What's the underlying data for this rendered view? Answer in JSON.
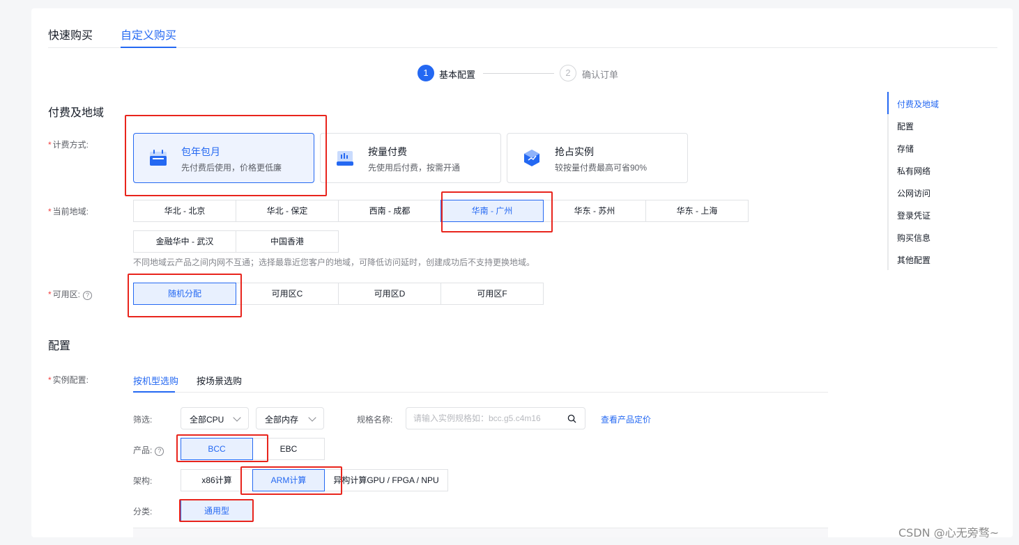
{
  "top_tabs": [
    {
      "label": "快速购买",
      "active": false
    },
    {
      "label": "自定义购买",
      "active": true
    }
  ],
  "steps": [
    {
      "num": "1",
      "label": "基本配置",
      "active": true
    },
    {
      "num": "2",
      "label": "确认订单",
      "active": false
    }
  ],
  "sections": {
    "billing_region": "付费及地域",
    "config": "配置"
  },
  "billing": {
    "label": "计费方式:",
    "cards": [
      {
        "title": "包年包月",
        "desc": "先付费后使用，价格更低廉",
        "icon": "calendar-icon",
        "selected": true
      },
      {
        "title": "按量付费",
        "desc": "先使用后付费，按需开通",
        "icon": "meter-icon",
        "selected": false
      },
      {
        "title": "抢占实例",
        "desc": "较按量付费最高可省90%",
        "icon": "cube-icon",
        "selected": false
      }
    ]
  },
  "region": {
    "label": "当前地域:",
    "options": [
      "华北 - 北京",
      "华北 - 保定",
      "西南 - 成都",
      "华南 - 广州",
      "华东 - 苏州",
      "华东 - 上海",
      "金融华中 - 武汉",
      "中国香港"
    ],
    "selected": "华南 - 广州",
    "hint": "不同地域云产品之间内网不互通；选择最靠近您客户的地域，可降低访问延时，创建成功后不支持更换地域。"
  },
  "zone": {
    "label": "可用区:",
    "help": "?",
    "options": [
      "随机分配",
      "可用区C",
      "可用区D",
      "可用区F"
    ],
    "selected": "随机分配"
  },
  "right_nav": {
    "items": [
      "付费及地域",
      "配置",
      "存储",
      "私有网络",
      "公网访问",
      "登录凭证",
      "购买信息",
      "其他配置"
    ],
    "active": "付费及地域"
  },
  "instance": {
    "label": "实例配置:",
    "tabs": [
      {
        "label": "按机型选购",
        "active": true
      },
      {
        "label": "按场景选购",
        "active": false
      }
    ],
    "filter_label": "筛选:",
    "cpu_select": "全部CPU",
    "mem_select": "全部内存",
    "spec_label": "规格名称:",
    "spec_placeholder": "请输入实例规格如：bcc.g5.c4m16",
    "pricing_link": "查看产品定价",
    "product_label": "产品:",
    "products": [
      "BCC",
      "EBC"
    ],
    "product_selected": "BCC",
    "arch_label": "架构:",
    "archs": [
      "x86计算",
      "ARM计算",
      "异构计算GPU / FPGA / NPU"
    ],
    "arch_selected": "ARM计算",
    "category_label": "分类:",
    "categories": [
      "通用型"
    ],
    "category_selected": "通用型"
  },
  "watermark": "CSDN @心无旁骛~",
  "colors": {
    "accent": "#2468f2",
    "highlight_red": "#e8241c",
    "required_star": "#f33e3e"
  }
}
